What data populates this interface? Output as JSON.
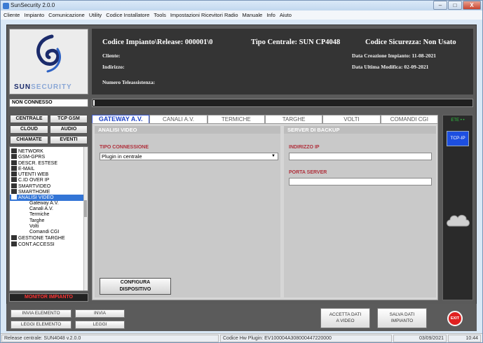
{
  "window": {
    "title": "SunSecurity 2.0.0",
    "controls": {
      "minimize": "–",
      "maximize": "□",
      "close": "X"
    }
  },
  "menu": [
    "Cliente",
    "Impianto",
    "Comunicazione",
    "Utility",
    "Codice Installatore",
    "Tools",
    "Impostazioni Ricevitori Radio",
    "Manuale",
    "Info",
    "Aiuto"
  ],
  "logo": {
    "text_sun": "SUN",
    "text_security": "SECURITY"
  },
  "header": {
    "codice": "Codice Impianto\\Release: 000001\\0",
    "tipo_centrale": "Tipo Centrale: SUN CP4048",
    "codice_sicurezza": "Codice Sicurezza: Non Usato",
    "cliente_label": "Cliente:",
    "indirizzo_label": "Indirizzo:",
    "data_creazione": "Data Creazione Impianto: 11-08-2021",
    "data_modifica": "Data Ultima Modifica: 02-09-2021",
    "numero_teleassistenza": "Numero Teleassistenza:"
  },
  "connection_status": "NON CONNESSO",
  "comm_buttons": [
    "CENTRALE",
    "TCP GSM",
    "CLOUD",
    "AUDIO",
    "CHIAMATE",
    "EVENTI"
  ],
  "nav_items": [
    {
      "label": "NETWORK",
      "icon": "network-icon",
      "sub": false,
      "selected": false
    },
    {
      "label": "GSM-GPRS",
      "icon": "gsm-icon",
      "sub": false,
      "selected": false
    },
    {
      "label": "DESCR. ESTESE",
      "icon": "list-icon",
      "sub": false,
      "selected": false
    },
    {
      "label": "E-MAIL",
      "icon": "email-icon",
      "sub": false,
      "selected": false
    },
    {
      "label": "UTENTI WEB",
      "icon": "users-icon",
      "sub": false,
      "selected": false
    },
    {
      "label": "C.ID OVER IP",
      "icon": "phone-icon",
      "sub": false,
      "selected": false
    },
    {
      "label": "SMARTVIDEO",
      "icon": "video-icon",
      "sub": false,
      "selected": false
    },
    {
      "label": "SMARTHOME",
      "icon": "home-icon",
      "sub": false,
      "selected": false
    },
    {
      "label": "ANALISI VIDEO",
      "icon": "camera-icon",
      "sub": false,
      "selected": true
    },
    {
      "label": "Gateway A.V.",
      "icon": "",
      "sub": true,
      "selected": false
    },
    {
      "label": "Canali A.V.",
      "icon": "",
      "sub": true,
      "selected": false
    },
    {
      "label": "Termiche",
      "icon": "",
      "sub": true,
      "selected": false
    },
    {
      "label": "Targhe",
      "icon": "",
      "sub": true,
      "selected": false
    },
    {
      "label": "Volti",
      "icon": "",
      "sub": true,
      "selected": false
    },
    {
      "label": "Comandi CGI",
      "icon": "",
      "sub": true,
      "selected": false
    },
    {
      "label": "GESTIONE TARGHE",
      "icon": "plate-icon",
      "sub": false,
      "selected": false
    },
    {
      "label": "CONT.ACCESSI",
      "icon": "access-icon",
      "sub": false,
      "selected": false
    }
  ],
  "monitor_label": "MONITOR IMPIANTO",
  "tabs": [
    "GATEWAY A.V.",
    "CANALI A.V.",
    "TERMICHE",
    "TARGHE",
    "VOLTI",
    "COMANDI CGI"
  ],
  "active_tab": 0,
  "analisi_video": {
    "title": "ANALISI VIDEO",
    "tipo_connessione_label": "TIPO CONNESSIONE",
    "tipo_connessione_value": "Plugin in centrale"
  },
  "server_backup": {
    "title": "SERVER DI BACKUP",
    "indirizzo_ip_label": "INDIRIZZO IP",
    "indirizzo_ip_value": "",
    "porta_server_label": "PORTA SERVER",
    "porta_server_value": ""
  },
  "configura_button": [
    "CONFIGURA",
    "DISPOSITIVO"
  ],
  "right_panel": {
    "top_label": "ETE • •",
    "tcp_button": "TCP-IP"
  },
  "bottom_buttons": {
    "invia_elemento": "INVIA ELEMENTO",
    "invia": "INVIA",
    "leggi_elemento": "LEGGI ELEMENTO",
    "leggi": "LEGGI",
    "accetta_dati": [
      "ACCETTA DATI",
      "A VIDEO"
    ],
    "salva_dati": [
      "SALVA DATI",
      "IMPIANTO"
    ],
    "exit": "EXIT"
  },
  "statusbar": {
    "release": "Release centrale: SUN4048  v.2.0.0",
    "plugin": "Codice Hw Plugin: EV100004A308000447220000",
    "date": "03/09/2021",
    "time": "10:44"
  },
  "colors": {
    "accent_blue": "#3375d6",
    "label_red": "#b0303c",
    "header_bg": "#343434",
    "exit_red": "#e02020"
  }
}
